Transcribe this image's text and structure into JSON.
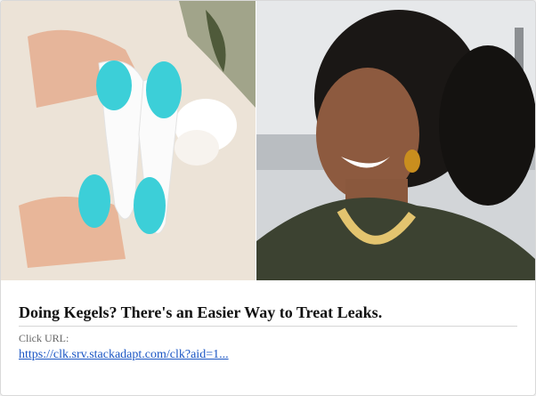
{
  "ad": {
    "headline": "Doing Kegels? There's an Easier Way to Treat Leaks.",
    "click_label": "Click URL:",
    "click_url": "https://clk.srv.stackadapt.com/clk?aid=1...",
    "images": [
      {
        "name": "product-image",
        "alt": "Hands holding a white and teal device"
      },
      {
        "name": "woman-photo",
        "alt": "Smiling woman with curly hair and necklace"
      }
    ]
  },
  "colors": {
    "link": "#1a55c4",
    "headline": "#111111",
    "teal": "#3ccfd8",
    "background": "#f1f1f1"
  }
}
